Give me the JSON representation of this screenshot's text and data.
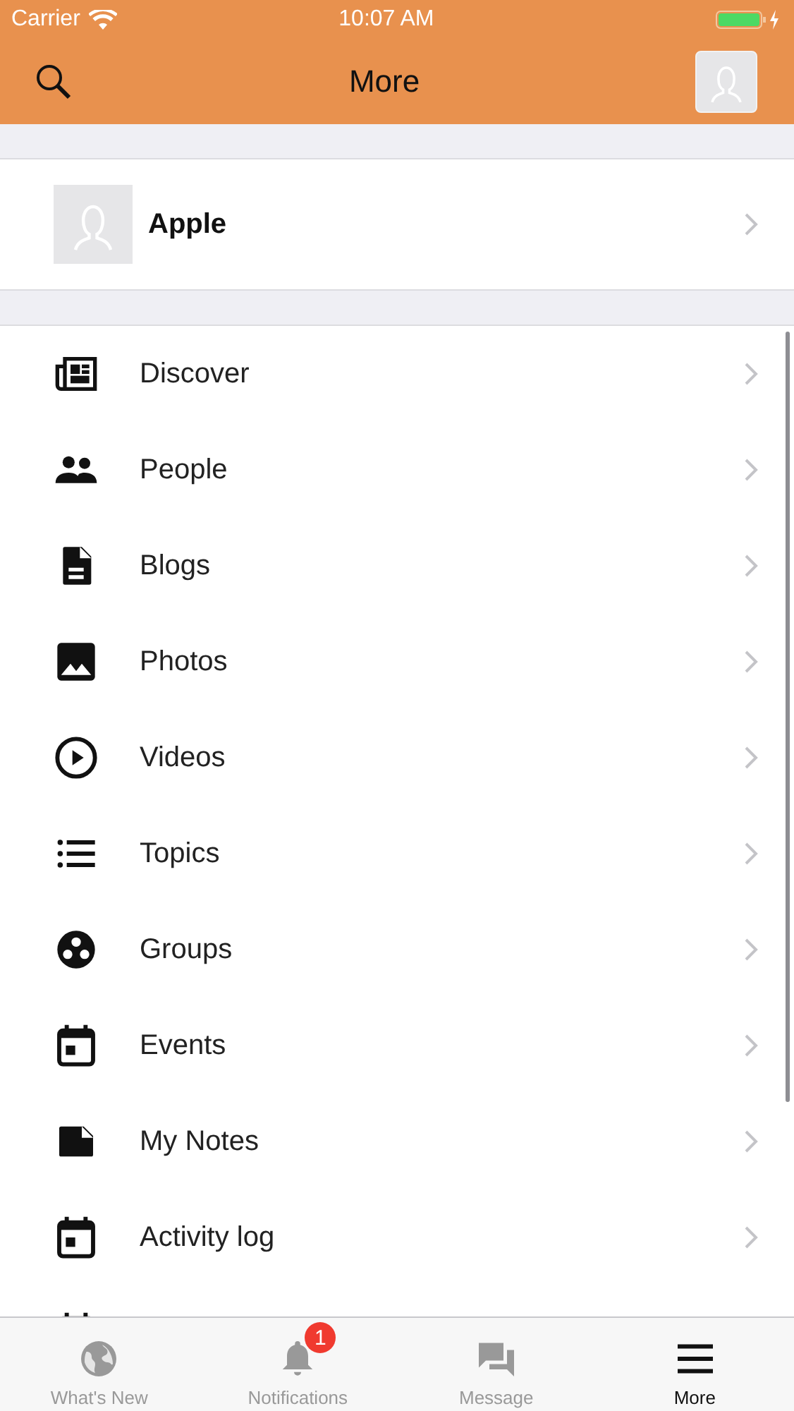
{
  "status_bar": {
    "carrier": "Carrier",
    "time": "10:07 AM"
  },
  "nav_bar": {
    "title": "More"
  },
  "profile": {
    "name": "Apple"
  },
  "menu_items": [
    {
      "label": "Discover",
      "kind": "newspaper"
    },
    {
      "label": "People",
      "kind": "people"
    },
    {
      "label": "Blogs",
      "kind": "document"
    },
    {
      "label": "Photos",
      "kind": "image"
    },
    {
      "label": "Videos",
      "kind": "play"
    },
    {
      "label": "Topics",
      "kind": "list"
    },
    {
      "label": "Groups",
      "kind": "groups"
    },
    {
      "label": "Events",
      "kind": "calendar"
    },
    {
      "label": "My Notes",
      "kind": "note"
    },
    {
      "label": "Activity log",
      "kind": "calendar"
    },
    {
      "kind": "calendar"
    }
  ],
  "tab_bar": [
    {
      "label": "What's New",
      "kind": "globe",
      "selected": false
    },
    {
      "label": "Notifications",
      "kind": "bell",
      "selected": false,
      "badge": "1"
    },
    {
      "label": "Message",
      "kind": "chat",
      "selected": false
    },
    {
      "label": "More",
      "kind": "menu",
      "selected": true
    }
  ]
}
